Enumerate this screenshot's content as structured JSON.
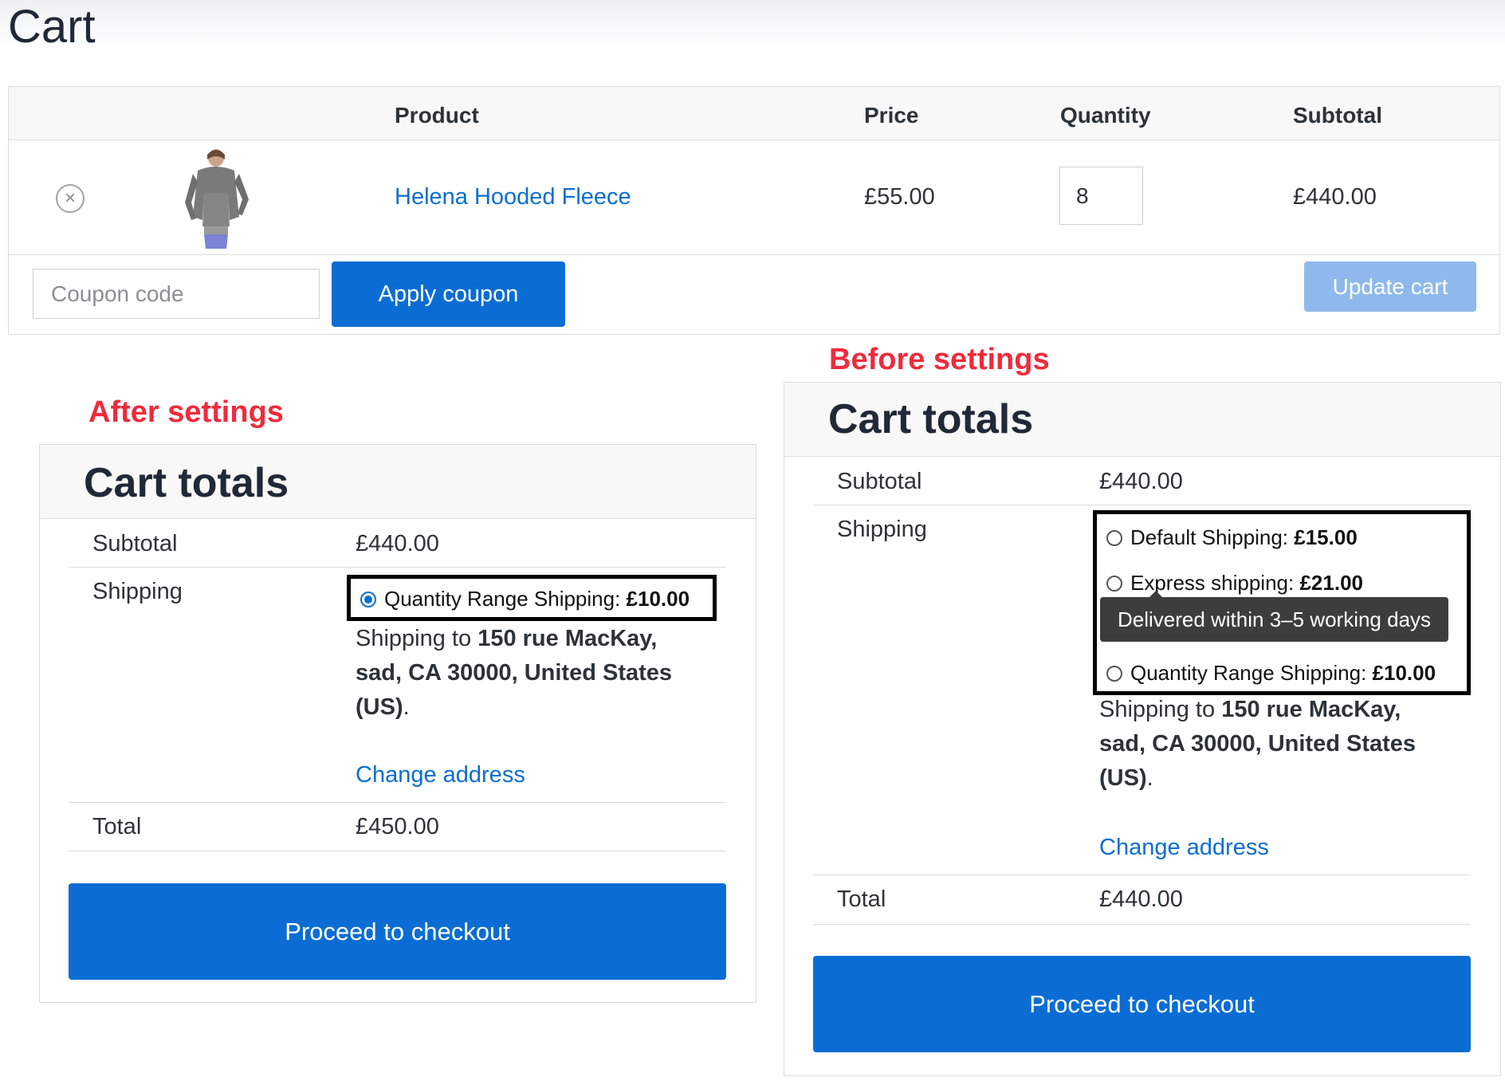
{
  "page": {
    "title": "Cart"
  },
  "cart_table": {
    "headers": {
      "product": "Product",
      "price": "Price",
      "quantity": "Quantity",
      "subtotal": "Subtotal"
    },
    "items": [
      {
        "name": "Helena Hooded Fleece",
        "price": "£55.00",
        "quantity": "8",
        "subtotal": "£440.00"
      }
    ],
    "coupon_placeholder": "Coupon code",
    "apply_coupon_label": "Apply coupon",
    "update_cart_label": "Update cart"
  },
  "annotations": {
    "after": "After settings",
    "before": "Before settings"
  },
  "after_totals": {
    "title": "Cart totals",
    "subtotal_label": "Subtotal",
    "subtotal_value": "£440.00",
    "shipping_label": "Shipping",
    "shipping_option": {
      "name": "Quantity Range Shipping:",
      "price": "£10.00",
      "selected": true
    },
    "address_prefix": "Shipping to",
    "address_line1": "150 rue MacKay,",
    "address_line2": "sad, CA 30000, United States",
    "address_line3": "(US)",
    "address_suffix": ".",
    "change_address": "Change address",
    "total_label": "Total",
    "total_value": "£450.00",
    "checkout_label": "Proceed to checkout"
  },
  "before_totals": {
    "title": "Cart totals",
    "subtotal_label": "Subtotal",
    "subtotal_value": "£440.00",
    "shipping_label": "Shipping",
    "shipping_options": [
      {
        "name": "Default Shipping:",
        "price": "£15.00",
        "selected": false
      },
      {
        "name": "Express shipping:",
        "price": "£21.00",
        "selected": false
      },
      {
        "name": "Quantity Range Shipping:",
        "price": "£10.00",
        "selected": false
      }
    ],
    "tooltip": "Delivered within 3–5 working days",
    "address_prefix": "Shipping to",
    "address_line1": "150 rue MacKay,",
    "address_line2": "sad, CA 30000, United States",
    "address_line3": "(US)",
    "address_suffix": ".",
    "change_address": "Change address",
    "total_label": "Total",
    "total_value": "£440.00",
    "checkout_label": "Proceed to checkout"
  },
  "colors": {
    "accent": "#0b6dd4",
    "link": "#0a6ed1",
    "annotation": "#ee2b3c",
    "update_disabled": "#8fb9ec"
  },
  "icons": {
    "remove": "close-circle-icon"
  }
}
